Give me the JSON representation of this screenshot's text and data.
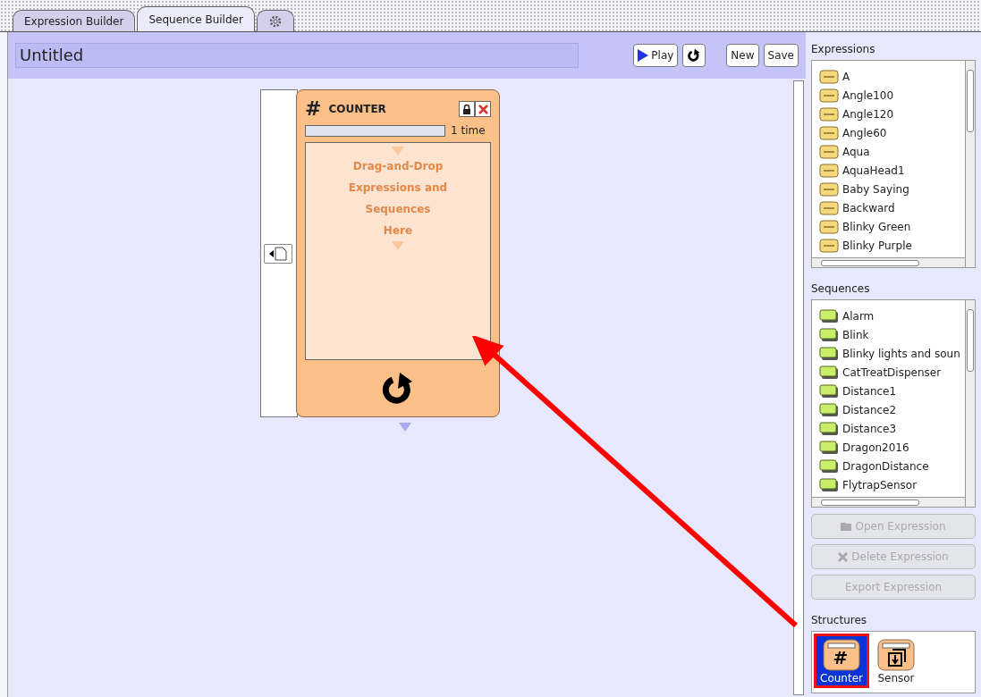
{
  "tabs": [
    {
      "kind": "text",
      "label": "Expression Builder",
      "selected": false
    },
    {
      "kind": "text",
      "label": "Sequence Builder",
      "selected": true
    },
    {
      "kind": "settings",
      "selected": false
    }
  ],
  "title_field": {
    "value": "Untitled"
  },
  "toolbar": [
    {
      "kind": "play",
      "label": "Play"
    },
    {
      "kind": "loop"
    },
    {
      "kind": "text",
      "label": "New"
    },
    {
      "kind": "text",
      "label": "Save"
    }
  ],
  "counter_block": {
    "icon": "#",
    "title": "COUNTER",
    "repeat": "1 time",
    "drop_hint": "Drag-and-Drop\nExpressions and\nSequences\nHere"
  },
  "expressions": {
    "label": "Expressions",
    "items": [
      "A",
      "Angle100",
      "Angle120",
      "Angle60",
      "Aqua",
      "AquaHead1",
      "Baby Saying",
      "Backward",
      "Blinky Green",
      "Blinky Purple"
    ]
  },
  "sequences": {
    "label": "Sequences",
    "items": [
      "Alarm",
      "Blink",
      "Blinky lights and soun",
      "CatTreatDispenser",
      "Distance1",
      "Distance2",
      "Distance3",
      "Dragon2016",
      "DragonDistance",
      "FlytrapSensor"
    ]
  },
  "actions": [
    {
      "kind": "open",
      "label": "Open Expression",
      "disabled": true
    },
    {
      "kind": "delete",
      "label": "Delete Expression",
      "disabled": true
    },
    {
      "kind": "plain",
      "label": "Export Expression",
      "disabled": true
    }
  ],
  "structures": {
    "label": "Structures",
    "items": [
      {
        "kind": "counter",
        "icon": "#",
        "label": "Counter",
        "selected": true
      },
      {
        "kind": "sensor",
        "label": "Sensor",
        "selected": false
      }
    ]
  }
}
